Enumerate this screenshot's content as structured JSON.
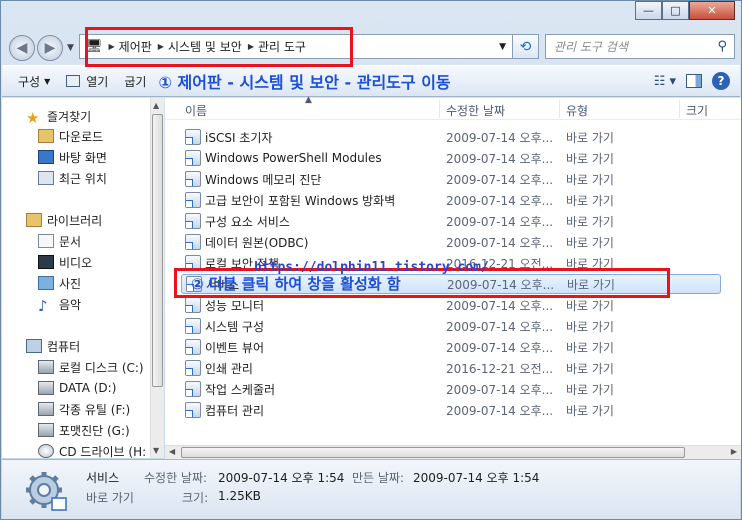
{
  "window": {
    "minimize": "0",
    "maximize": "1",
    "close": "r"
  },
  "address": {
    "segments": [
      "제어판",
      "시스템 및 보안",
      "관리 도구"
    ]
  },
  "search": {
    "placeholder": "관리 도구 검색"
  },
  "toolbar": {
    "organize": "구성",
    "open": "열기",
    "burn": "굽기",
    "annotation1": "① 제어판 - 시스템 및 보안 - 관리도구 이동",
    "help": "?"
  },
  "nav": {
    "favorites": "즐겨찾기",
    "downloads": "다운로드",
    "desktop": "바탕 화면",
    "recent": "최근 위치",
    "libraries": "라이브러리",
    "documents": "문서",
    "videos": "비디오",
    "pictures": "사진",
    "music": "음악",
    "computer": "컴퓨터",
    "local_disk": "로컬 디스크 (C:)",
    "data": "DATA (D:)",
    "tools": "각종 유틸 (F:)",
    "format": "포맷진단 (G:)",
    "cd": "CD 드라이브 (H:"
  },
  "columns": {
    "name": "이름",
    "modified": "수정한 날짜",
    "type": "유형",
    "size": "크기"
  },
  "files": [
    {
      "name": "iSCSI 초기자",
      "date": "2009-07-14 오후...",
      "type": "바로 가기"
    },
    {
      "name": "Windows PowerShell Modules",
      "date": "2009-07-14 오후...",
      "type": "바로 가기"
    },
    {
      "name": "Windows 메모리 진단",
      "date": "2009-07-14 오후...",
      "type": "바로 가기"
    },
    {
      "name": "고급 보안이 포함된 Windows 방화벽",
      "date": "2009-07-14 오후...",
      "type": "바로 가기"
    },
    {
      "name": "구성 요소 서비스",
      "date": "2009-07-14 오후...",
      "type": "바로 가기"
    },
    {
      "name": "데이터 원본(ODBC)",
      "date": "2009-07-14 오후...",
      "type": "바로 가기"
    },
    {
      "name": "로컬 보안 정책",
      "date": "2016-12-21 오전...",
      "type": "바로 가기"
    },
    {
      "name": "서비스",
      "date": "2009-07-14 오후...",
      "type": "바로 가기"
    },
    {
      "name": "성능 모니터",
      "date": "2009-07-14 오후...",
      "type": "바로 가기"
    },
    {
      "name": "시스템 구성",
      "date": "2009-07-14 오후...",
      "type": "바로 가기"
    },
    {
      "name": "이벤트 뷰어",
      "date": "2009-07-14 오후...",
      "type": "바로 가기"
    },
    {
      "name": "인쇄 관리",
      "date": "2016-12-21 오전...",
      "type": "바로 가기"
    },
    {
      "name": "작업 스케줄러",
      "date": "2009-07-14 오후...",
      "type": "바로 가기"
    },
    {
      "name": "컴퓨터 관리",
      "date": "2009-07-14 오후...",
      "type": "바로 가기"
    }
  ],
  "annotation2": "② 더블 클릭 하여 창을 활성화 함",
  "watermark": "https://dolphin11.tistory.com/",
  "details": {
    "name": "서비스",
    "type": "바로 가기",
    "modified_label": "수정한 날짜:",
    "modified_value": "2009-07-14 오후 1:54",
    "created_label": "만든 날짜:",
    "created_value": "2009-07-14 오후 1:54",
    "size_label": "크기:",
    "size_value": "1.25KB"
  },
  "colors": {
    "highlight_box": "#e8141c",
    "annotation_text": "#1b4fd6"
  }
}
